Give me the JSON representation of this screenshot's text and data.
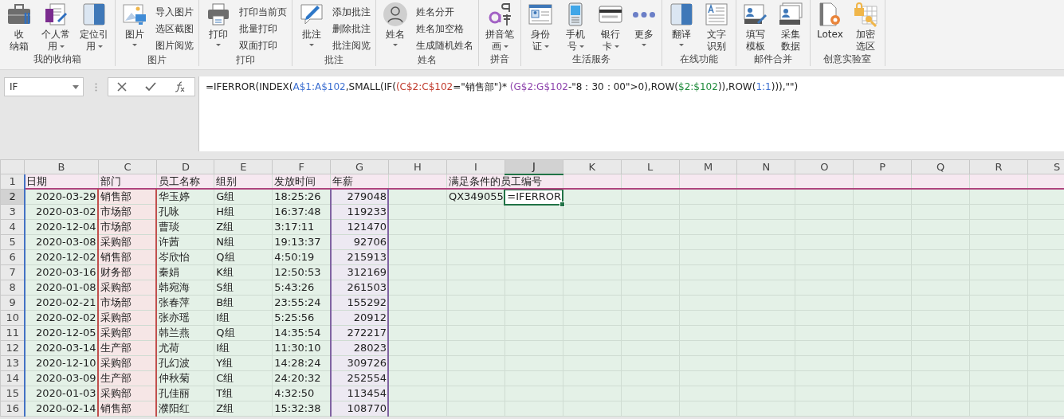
{
  "ribbon": {
    "groups": [
      {
        "label": "我的收纳箱",
        "items": [
          {
            "kind": "large",
            "lines": [
              "收",
              "纳箱"
            ],
            "dropdown": false
          },
          {
            "kind": "large",
            "lines": [
              "个人常",
              "用"
            ],
            "dropdown": true
          },
          {
            "kind": "large",
            "lines": [
              "定位引",
              "用"
            ],
            "dropdown": true
          }
        ]
      },
      {
        "label": "图片",
        "items": [
          {
            "kind": "large",
            "lines": [
              "图片"
            ],
            "dropdown": true
          }
        ],
        "menu": [
          "导入图片",
          "选区截图",
          "图片阅览"
        ]
      },
      {
        "label": "打印",
        "items": [
          {
            "kind": "large",
            "lines": [
              "打印"
            ],
            "dropdown": true
          }
        ],
        "menu": [
          "打印当前页",
          "批量打印",
          "双面打印"
        ]
      },
      {
        "label": "批注",
        "items": [
          {
            "kind": "large",
            "lines": [
              "批注"
            ],
            "dropdown": true
          }
        ],
        "menu": [
          "添加批注",
          "删除批注",
          "批注阅览"
        ]
      },
      {
        "label": "姓名",
        "items": [
          {
            "kind": "large",
            "lines": [
              "姓名"
            ],
            "dropdown": true
          }
        ],
        "menu": [
          "姓名分开",
          "姓名加空格",
          "生成随机姓名"
        ]
      },
      {
        "label": "拼音",
        "items": [
          {
            "kind": "large",
            "lines": [
              "拼音笔",
              "画"
            ],
            "dropdown": true
          }
        ]
      },
      {
        "label": "生活服务",
        "items": [
          {
            "kind": "large",
            "lines": [
              "身份",
              "证"
            ],
            "dropdown": true
          },
          {
            "kind": "large",
            "lines": [
              "手机",
              "号"
            ],
            "dropdown": true
          },
          {
            "kind": "large",
            "lines": [
              "银行",
              "卡"
            ],
            "dropdown": true
          },
          {
            "kind": "large",
            "lines": [
              "更多"
            ],
            "dropdown": true
          }
        ]
      },
      {
        "label": "在线功能",
        "items": [
          {
            "kind": "large",
            "lines": [
              "翻译"
            ],
            "dropdown": true
          },
          {
            "kind": "large",
            "lines": [
              "文字",
              "识别"
            ],
            "dropdown": false
          }
        ]
      },
      {
        "label": "邮件合并",
        "items": [
          {
            "kind": "large",
            "lines": [
              "填写",
              "模板"
            ],
            "dropdown": false
          },
          {
            "kind": "large",
            "lines": [
              "采集",
              "数据"
            ],
            "dropdown": false
          }
        ]
      },
      {
        "label": "创意实验室",
        "items": [
          {
            "kind": "large",
            "lines": [
              "Lotex"
            ],
            "dropdown": false
          },
          {
            "kind": "large",
            "lines": [
              "加密",
              "选区"
            ],
            "dropdown": false
          }
        ]
      }
    ]
  },
  "formula_bar": {
    "name_box": "IF",
    "formula": [
      {
        "text": "=IFERROR(INDEX(",
        "color": "#222222"
      },
      {
        "text": "A$1:A$102",
        "color": "#3c6fd1"
      },
      {
        "text": ",SMALL(IF(",
        "color": "#222222"
      },
      {
        "text": "(C$2:C$102",
        "color": "#c0392b"
      },
      {
        "text": "=\"销售部\")* ",
        "color": "#222222"
      },
      {
        "text": "(G$2:G$102",
        "color": "#8e44ad"
      },
      {
        "text": "-\"8：30：00\">0),ROW(",
        "color": "#222222"
      },
      {
        "text": "$2:$102",
        "color": "#1e8a3a"
      },
      {
        "text": ")),ROW(",
        "color": "#222222"
      },
      {
        "text": "1:1",
        "color": "#3c6fd1"
      },
      {
        "text": "))),\"\")",
        "color": "#222222"
      }
    ]
  },
  "sheet": {
    "columns": [
      {
        "label": "B",
        "selected": false,
        "range": {
          "color": "#4472c4",
          "shaded": false
        }
      },
      {
        "label": "C",
        "selected": false,
        "range": {
          "color": "#c0504d",
          "shaded": true
        }
      },
      {
        "label": "D",
        "selected": false
      },
      {
        "label": "E",
        "selected": false
      },
      {
        "label": "F",
        "selected": false
      },
      {
        "label": "G",
        "selected": false,
        "range": {
          "color": "#8064a2",
          "shaded": true
        }
      },
      {
        "label": "H",
        "selected": false
      },
      {
        "label": "I",
        "selected": false
      },
      {
        "label": "J",
        "selected": true
      },
      {
        "label": "K",
        "selected": false
      },
      {
        "label": "L",
        "selected": false
      },
      {
        "label": "M",
        "selected": false
      },
      {
        "label": "N",
        "selected": false
      },
      {
        "label": "O",
        "selected": false
      },
      {
        "label": "P",
        "selected": false
      },
      {
        "label": "Q",
        "selected": false
      },
      {
        "label": "R",
        "selected": false
      },
      {
        "label": "S",
        "selected": false
      }
    ],
    "rows": [
      {
        "number": "1",
        "selected": false,
        "range": {
          "color": "#b0437e",
          "shaded": true
        },
        "cells": {
          "B": "日期",
          "C": "部门",
          "D": "员工名称",
          "E": "组别",
          "F": "发放时间",
          "G": "年薪",
          "I": "满足条件的员工编号"
        }
      },
      {
        "number": "2",
        "selected": true,
        "cells": {
          "B": "2020-03-29",
          "C": "销售部",
          "D": "华玉婷",
          "E": "G组",
          "F": "18:25:26",
          "G": "279048",
          "I": "QX349055",
          "J": "=IFERROR"
        }
      },
      {
        "number": "3",
        "selected": false,
        "cells": {
          "B": "2020-03-02",
          "C": "市场部",
          "D": "孔咏",
          "E": "H组",
          "F": "16:37:48",
          "G": "119233"
        }
      },
      {
        "number": "4",
        "selected": false,
        "cells": {
          "B": "2020-12-04",
          "C": "市场部",
          "D": "曹琰",
          "E": "Z组",
          "F": "3:17:11",
          "G": "121470"
        }
      },
      {
        "number": "5",
        "selected": false,
        "cells": {
          "B": "2020-03-08",
          "C": "采购部",
          "D": "许茜",
          "E": "N组",
          "F": "19:13:37",
          "G": "92706"
        }
      },
      {
        "number": "6",
        "selected": false,
        "cells": {
          "B": "2020-12-02",
          "C": "销售部",
          "D": "岑欣怡",
          "E": "Q组",
          "F": "4:50:19",
          "G": "215913"
        }
      },
      {
        "number": "7",
        "selected": false,
        "cells": {
          "B": "2020-03-16",
          "C": "财务部",
          "D": "秦娟",
          "E": "K组",
          "F": "12:50:53",
          "G": "312169"
        }
      },
      {
        "number": "8",
        "selected": false,
        "cells": {
          "B": "2020-01-08",
          "C": "采购部",
          "D": "韩宛海",
          "E": "S组",
          "F": "5:43:26",
          "G": "261503"
        }
      },
      {
        "number": "9",
        "selected": false,
        "cells": {
          "B": "2020-02-21",
          "C": "市场部",
          "D": "张春萍",
          "E": "B组",
          "F": "23:55:24",
          "G": "155292"
        }
      },
      {
        "number": "10",
        "selected": false,
        "cells": {
          "B": "2020-02-02",
          "C": "采购部",
          "D": "张亦瑶",
          "E": "I组",
          "F": "5:25:56",
          "G": "20912"
        }
      },
      {
        "number": "11",
        "selected": false,
        "cells": {
          "B": "2020-12-05",
          "C": "采购部",
          "D": "韩兰燕",
          "E": "Q组",
          "F": "14:35:54",
          "G": "272217"
        }
      },
      {
        "number": "12",
        "selected": false,
        "cells": {
          "B": "2020-03-14",
          "C": "生产部",
          "D": "尤荷",
          "E": "I组",
          "F": "11:30:10",
          "G": "28023"
        }
      },
      {
        "number": "13",
        "selected": false,
        "cells": {
          "B": "2020-12-10",
          "C": "采购部",
          "D": "孔幻波",
          "E": "Y组",
          "F": "14:28:24",
          "G": "309726"
        }
      },
      {
        "number": "14",
        "selected": false,
        "cells": {
          "B": "2020-03-09",
          "C": "生产部",
          "D": "仲秋菊",
          "E": "C组",
          "F": "24:20:32",
          "G": "252554"
        }
      },
      {
        "number": "15",
        "selected": false,
        "cells": {
          "B": "2020-01-03",
          "C": "采购部",
          "D": "孔佳丽",
          "E": "T组",
          "F": "4:32:50",
          "G": "113454"
        }
      },
      {
        "number": "16",
        "selected": false,
        "cells": {
          "B": "2020-02-14",
          "C": "销售部",
          "D": "濮阳红",
          "E": "Z组",
          "F": "15:32:38",
          "G": "108770"
        }
      }
    ]
  }
}
